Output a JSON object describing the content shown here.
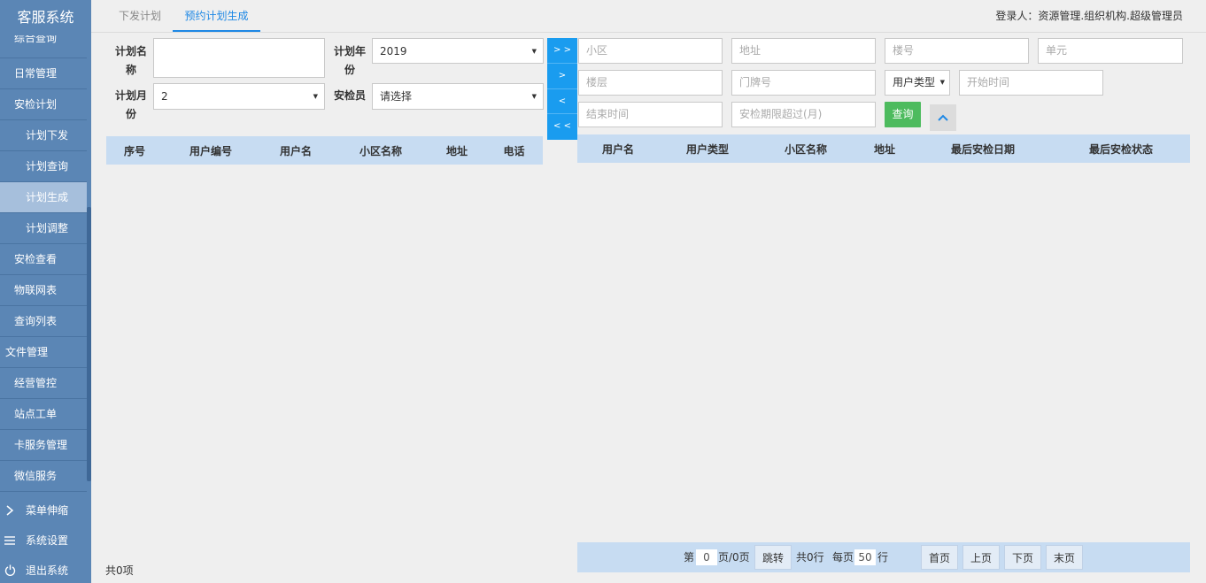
{
  "app": {
    "title": "客服系统"
  },
  "sidebar": {
    "cut_item": "综合查询",
    "items": [
      {
        "label": "日常管理",
        "level": 1
      },
      {
        "label": "安检计划",
        "level": 1
      },
      {
        "label": "计划下发",
        "level": 2
      },
      {
        "label": "计划查询",
        "level": 2
      },
      {
        "label": "计划生成",
        "level": 2,
        "active": true
      },
      {
        "label": "计划调整",
        "level": 2
      },
      {
        "label": "安检查看",
        "level": 1
      },
      {
        "label": "物联网表",
        "level": 1
      },
      {
        "label": "查询列表",
        "level": 1
      },
      {
        "label": "文件管理",
        "level": 0
      },
      {
        "label": "经营管控",
        "level": 1
      },
      {
        "label": "站点工单",
        "level": 1
      },
      {
        "label": "卡服务管理",
        "level": 1
      },
      {
        "label": "微信服务",
        "level": 1
      }
    ],
    "bottom": {
      "collapse_label": "菜单伸缩",
      "settings_label": "系统设置",
      "logout_label": "退出系统"
    }
  },
  "tabs": [
    {
      "label": "下发计划"
    },
    {
      "label": "预约计划生成",
      "active": true
    }
  ],
  "header": {
    "login_text": "登录人：资源管理.组织机构.超级管理员"
  },
  "form": {
    "plan_name_label": "计划名称",
    "plan_name_value": "",
    "plan_year_label": "计划年份",
    "plan_year_value": "2019",
    "plan_month_label": "计划月份",
    "plan_month_value": "2",
    "inspector_label": "安检员",
    "inspector_value": "请选择"
  },
  "left_table": {
    "columns": [
      "序号",
      "用户编号",
      "用户名",
      "小区名称",
      "地址",
      "电话"
    ],
    "rows": [],
    "total_text": "共0项"
  },
  "transfer": {
    "all_right": "> >",
    "right": ">",
    "left": "<",
    "all_left": "< <"
  },
  "filters": {
    "community": "小区",
    "address": "地址",
    "building": "楼号",
    "unit": "单元",
    "floor": "楼层",
    "door": "门牌号",
    "user_type": "用户类型",
    "start_time": "开始时间",
    "end_time": "结束时间",
    "period": "安检期限超过(月)",
    "query_label": "查询"
  },
  "right_table": {
    "columns": [
      "用户名",
      "用户类型",
      "小区名称",
      "地址",
      "最后安检日期",
      "最后安检状态"
    ],
    "rows": []
  },
  "pager": {
    "page_prefix": "第",
    "page_value": "0",
    "page_suffix": "页/0页",
    "jump_label": "跳转",
    "total_rows": "共0行",
    "per_page_prefix": "每页",
    "per_page_value": "50",
    "per_page_suffix": "行",
    "first": "首页",
    "prev": "上页",
    "next": "下页",
    "last": "末页"
  },
  "colors": {
    "sidebar": "#5b86b5",
    "sidebar_active": "#a6bfdc",
    "accent": "#1e88e5",
    "transfer": "#1a9cef",
    "query": "#4dbb5e",
    "table_header": "#c7dcf2"
  }
}
